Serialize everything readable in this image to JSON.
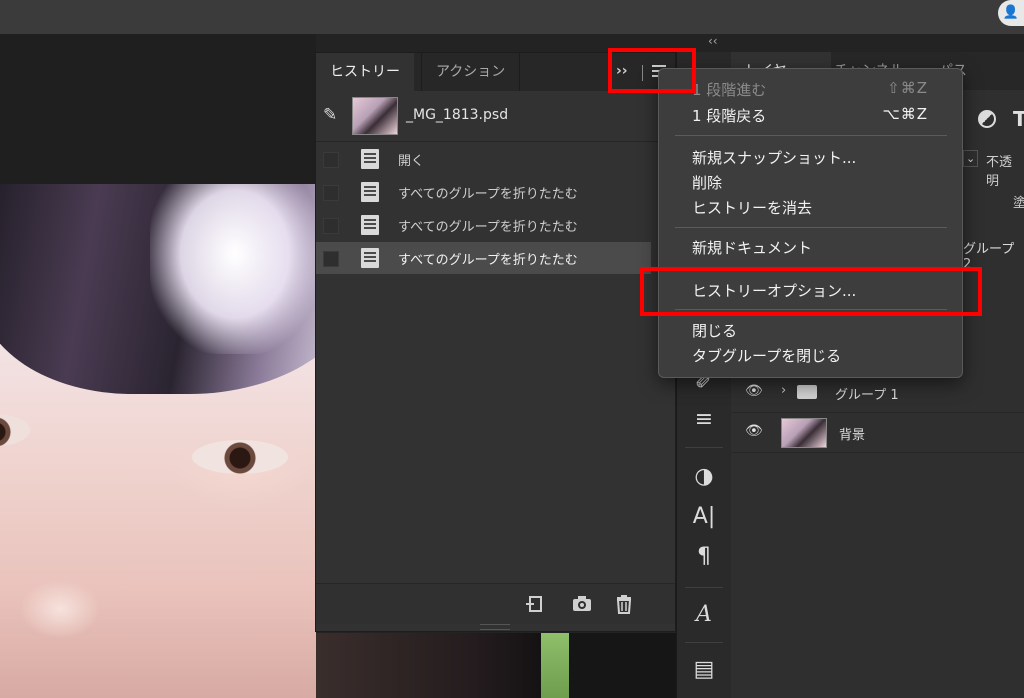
{
  "history_panel": {
    "tabs": [
      "ヒストリー",
      "アクション"
    ],
    "expand_symbol": "››",
    "snapshot_name": "_MG_1813.psd",
    "items": [
      {
        "label": "開く",
        "selected": false
      },
      {
        "label": "すべてのグループを折りたたむ",
        "selected": false
      },
      {
        "label": "すべてのグループを折りたたむ",
        "selected": false
      },
      {
        "label": "すべてのグループを折りたたむ",
        "selected": true
      }
    ],
    "footer_icons": [
      "new-document-from-state-icon",
      "camera-icon",
      "trash-icon"
    ]
  },
  "layers_panel": {
    "tabs": [
      "レイヤー",
      "チャンネル",
      "パス"
    ],
    "opacity_label": "不透明",
    "fill_label": "塗",
    "filter_t": "T",
    "layers": [
      {
        "name": "グループ 2",
        "type": "group"
      },
      {
        "name": "グループ 1",
        "type": "group"
      },
      {
        "name": "背景",
        "type": "image"
      }
    ]
  },
  "menu": {
    "sections": [
      [
        {
          "label": "1 段階進む",
          "shortcut": "⇧⌘Z",
          "disabled": true
        },
        {
          "label": "1 段階戻る",
          "shortcut": "⌥⌘Z",
          "disabled": false
        }
      ],
      [
        {
          "label": "新規スナップショット...",
          "disabled": false
        },
        {
          "label": "削除",
          "disabled": false
        },
        {
          "label": "ヒストリーを消去",
          "disabled": false
        }
      ],
      [
        {
          "label": "新規ドキュメント",
          "disabled": false
        }
      ],
      [
        {
          "label": "ヒストリーオプション...",
          "disabled": false,
          "highlighted": true
        }
      ],
      [
        {
          "label": "閉じる",
          "disabled": false
        },
        {
          "label": "タブグループを閉じる",
          "disabled": false
        }
      ]
    ]
  },
  "toolbar": {
    "collapse_symbol": "‹‹",
    "text_tool_glyph": "A|",
    "paragraph_glyph": "¶",
    "glyphs_glyph": "A"
  },
  "colors": {
    "highlight_red": "#ff0000",
    "panel_bg": "#323232",
    "menu_bg": "#3d3d3d"
  }
}
